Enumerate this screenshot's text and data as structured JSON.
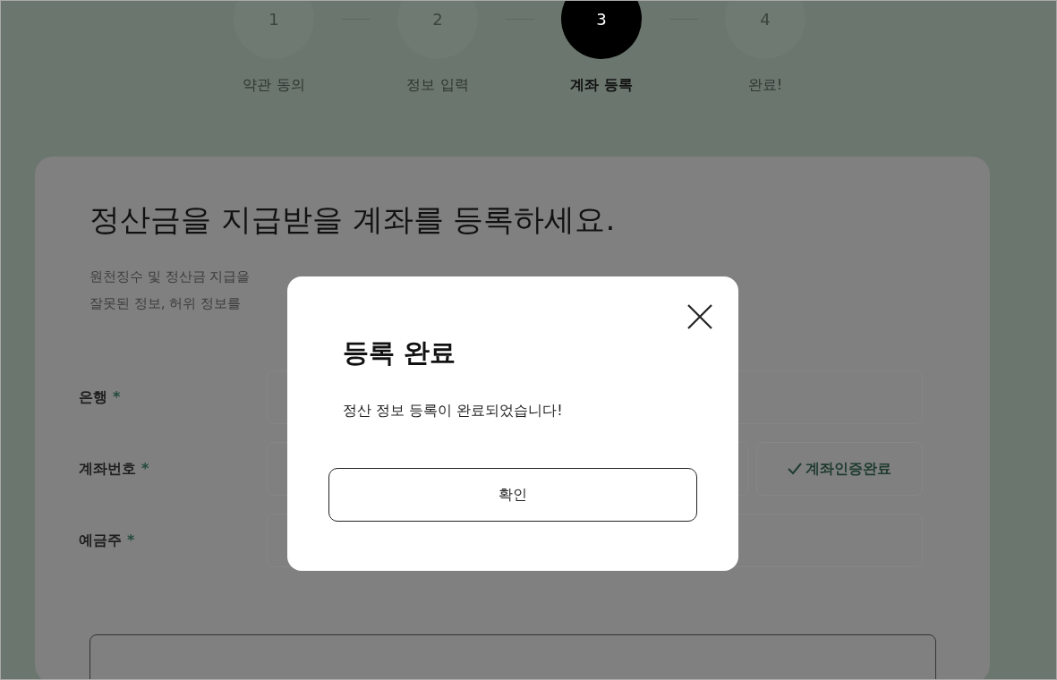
{
  "steps": [
    {
      "number": "1",
      "label": "약관 동의",
      "selected": false
    },
    {
      "number": "2",
      "label": "정보 입력",
      "selected": false
    },
    {
      "number": "3",
      "label": "계좌 등록",
      "selected": true
    },
    {
      "number": "4",
      "label": "완료!",
      "selected": false
    }
  ],
  "heading": "정산금을 지급받을 계좌를 등록하세요.",
  "description": [
    "원천징수 및 정산금 지급을",
    "잘못된 정보, 허위 정보를"
  ],
  "fields": [
    {
      "label": "은행",
      "required_mark": "*",
      "kind": "input"
    },
    {
      "label": "계좌번호",
      "required_mark": "*",
      "kind": "input_with_button",
      "button": "계좌인증완료",
      "verified": true
    },
    {
      "label": "예금주",
      "required_mark": "*",
      "kind": "input"
    }
  ],
  "modal": {
    "title": "등록 완료",
    "message": "정산 정보 등록이 완료되었습니다!",
    "confirm": "확인"
  }
}
